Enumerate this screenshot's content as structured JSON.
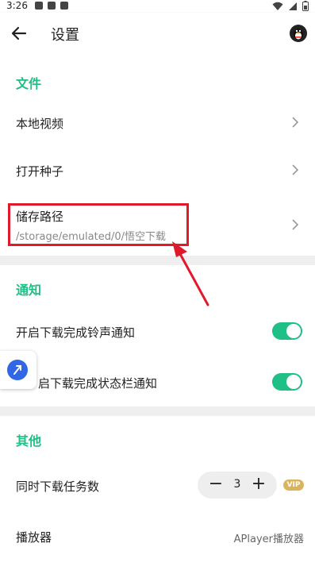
{
  "status": {
    "time": "3:26"
  },
  "appbar": {
    "title": "设置"
  },
  "sections": {
    "files": {
      "title": "文件",
      "local_video": "本地视频",
      "open_torrent": "打开种子",
      "storage_path": {
        "label": "储存路径",
        "value": "/storage/emulated/0/悟空下载"
      }
    },
    "notify": {
      "title": "通知",
      "ringtone": {
        "label": "开启下载完成铃声通知",
        "enabled": true
      },
      "statusbar": {
        "label": "启下载完成状态栏通知",
        "enabled": true
      }
    },
    "other": {
      "title": "其他",
      "concurrent": {
        "label": "同时下载任务数",
        "value": "3",
        "minus": "−",
        "plus": "+",
        "badge": "VIP"
      },
      "player": {
        "label": "播放器",
        "value": "APlayer播放器"
      }
    }
  },
  "colors": {
    "accent": "#1fbf86",
    "highlight": "#e0192b",
    "vip": "#d9b45c"
  }
}
